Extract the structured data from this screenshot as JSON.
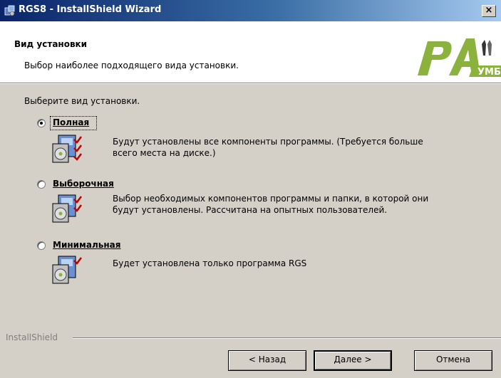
{
  "window": {
    "title": "RGS8 - InstallShield Wizard",
    "close_symbol": "×"
  },
  "header": {
    "title": "Вид установки",
    "subtitle": "Выбор наиболее подходящего вида установки."
  },
  "logo": {
    "icon": "rumb-logo"
  },
  "prompt": "Выберите вид установки.",
  "options": [
    {
      "label": "Полная",
      "checked": true,
      "description": "Будут установлены все компоненты программы. (Требуется больше всего места на диске.)"
    },
    {
      "label": "Выборочная",
      "checked": false,
      "description": "Выбор необходимых компонентов программы и папки, в которой они будут установлены. Рассчитана на опытных пользователей."
    },
    {
      "label": "Минимальная",
      "checked": false,
      "description": "Будет установлена только программа RGS"
    }
  ],
  "footer": {
    "brand": "InstallShield"
  },
  "buttons": {
    "back": "< Назад",
    "next": "Далее >",
    "cancel": "Отмена"
  },
  "colors": {
    "titlebar_start": "#0a246a",
    "titlebar_end": "#a6caf0",
    "face": "#d4d0c8",
    "logo_green": "#8bb23c"
  }
}
